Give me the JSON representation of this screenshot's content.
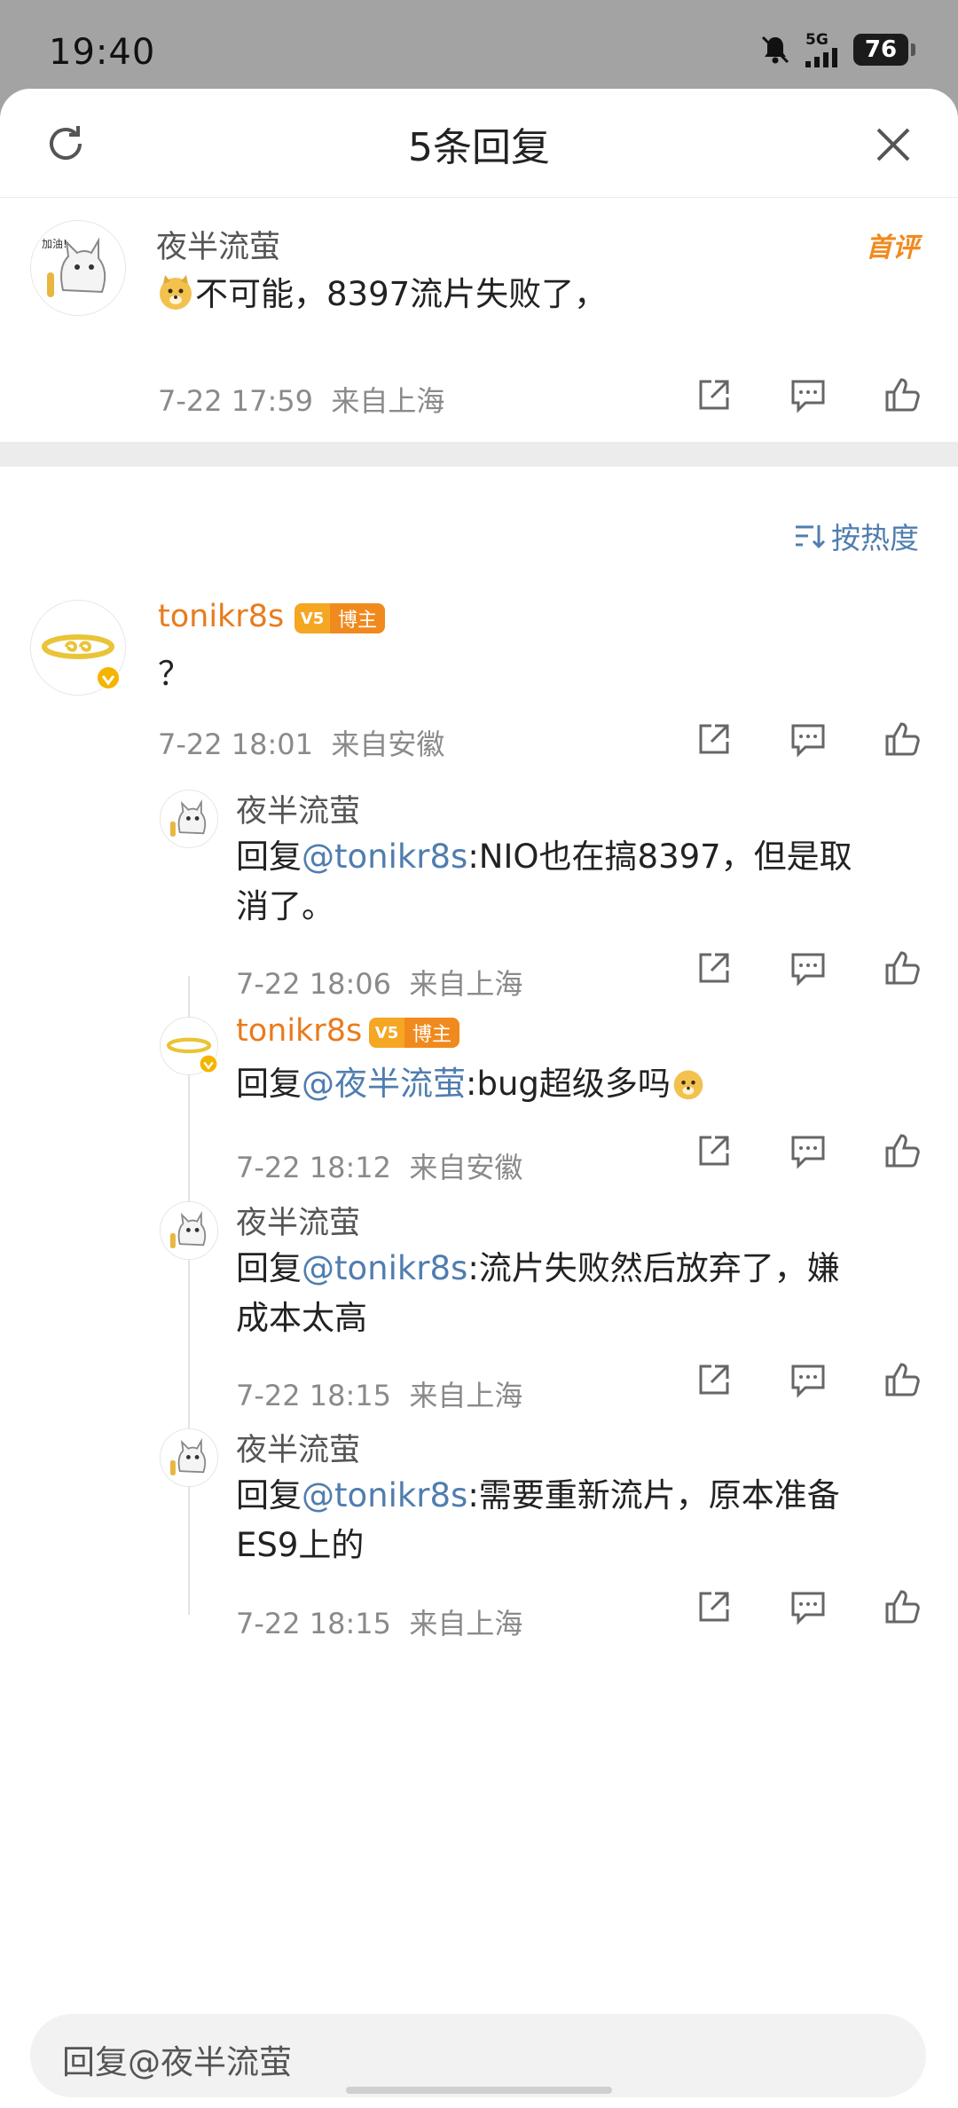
{
  "status_bar": {
    "time": "19:40",
    "network": "5G",
    "battery": "76"
  },
  "header": {
    "title": "5条回复"
  },
  "root_comment": {
    "author": "夜半流萤",
    "badge": "首评",
    "text": "不可能，8397流片失败了，",
    "time": "7-22 17:59",
    "location": "来自上海"
  },
  "sort": {
    "label": "按热度"
  },
  "main_comment": {
    "author": "tonikr8s",
    "role_badge": "博主",
    "text": "？",
    "time": "7-22 18:01",
    "location": "来自安徽"
  },
  "replies": [
    {
      "author": "夜半流萤",
      "prefix": "回复",
      "mention": "@tonikr8s",
      "line1": ":NIO也在搞8397，但是取",
      "line2": "消了。",
      "time": "7-22 18:06",
      "location": "来自上海"
    },
    {
      "author": "tonikr8s",
      "role_badge": "博主",
      "prefix": "回复",
      "mention": "@夜半流萤",
      "line1": ":bug超级多吗",
      "time": "7-22 18:12",
      "location": "来自安徽"
    },
    {
      "author": "夜半流萤",
      "prefix": "回复",
      "mention": "@tonikr8s",
      "line1": ":流片失败然后放弃了，嫌",
      "line2": "成本太高",
      "time": "7-22 18:15",
      "location": "来自上海"
    },
    {
      "author": "夜半流萤",
      "prefix": "回复",
      "mention": "@tonikr8s",
      "line1": ":需要重新流片，原本准备",
      "line2": "ES9上的",
      "time": "7-22 18:15",
      "location": "来自上海"
    }
  ],
  "reply_input": {
    "placeholder": "回复@夜半流萤"
  }
}
